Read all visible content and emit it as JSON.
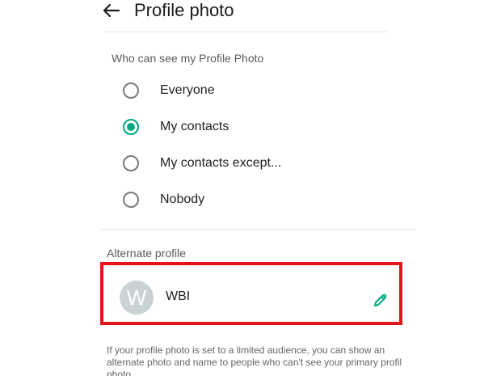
{
  "header": {
    "back_icon": "arrow-left-icon",
    "title": "Profile photo"
  },
  "visibility": {
    "section_title": "Who can see my Profile Photo",
    "selected": "My contacts",
    "options": [
      {
        "label": "Everyone",
        "checked": false
      },
      {
        "label": "My contacts",
        "checked": true
      },
      {
        "label": "My contacts except...",
        "checked": false
      },
      {
        "label": "Nobody",
        "checked": false
      }
    ]
  },
  "alternate_profile": {
    "section_title": "Alternate profile",
    "avatar_initial": "W",
    "name": "WBI",
    "edit_icon": "pencil-icon",
    "highlight_color": "#e3141b"
  },
  "footer": {
    "text": "If your profile photo is set to a limited audience, you can show an alternate photo and name to people who can't see your primary profil photo"
  },
  "colors": {
    "accent": "#00a884",
    "highlight": "#e3141b"
  }
}
